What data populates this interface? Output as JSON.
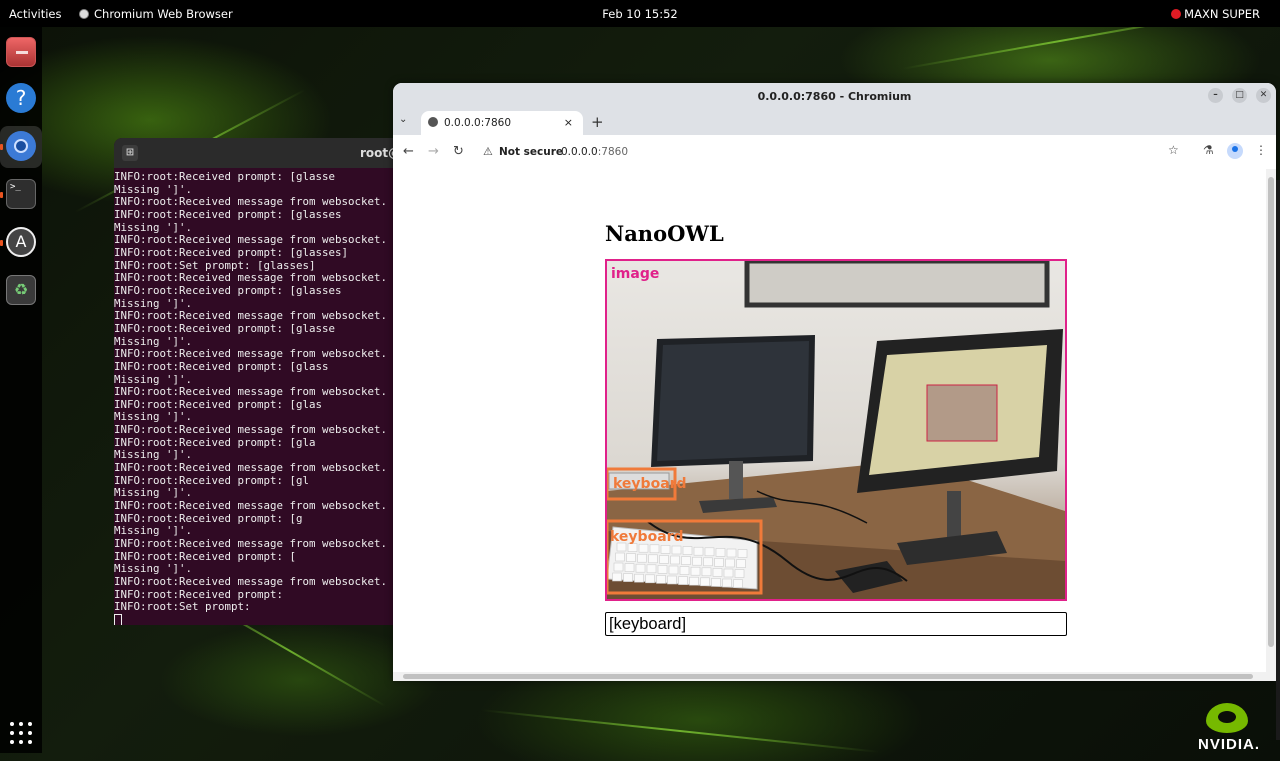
{
  "topbar": {
    "activities": "Activities",
    "app_name": "Chromium Web Browser",
    "clock": "Feb 10  15:52",
    "power_mode": "MAXN SUPER"
  },
  "dock": {
    "items": [
      "files-icon",
      "help-icon",
      "chromium-icon",
      "terminal-icon",
      "software-icon",
      "trash-icon"
    ],
    "terminal_glyph": ">_",
    "help_glyph": "?"
  },
  "terminal": {
    "title": "root@",
    "lines": [
      "INFO:root:Received prompt: [glasse",
      "Missing ']'.",
      "INFO:root:Received message from websocket.",
      "INFO:root:Received prompt: [glasses",
      "Missing ']'.",
      "INFO:root:Received message from websocket.",
      "INFO:root:Received prompt: [glasses]",
      "INFO:root:Set prompt: [glasses]",
      "INFO:root:Received message from websocket.",
      "INFO:root:Received prompt: [glasses",
      "Missing ']'.",
      "INFO:root:Received message from websocket.",
      "INFO:root:Received prompt: [glasse",
      "Missing ']'.",
      "INFO:root:Received message from websocket.",
      "INFO:root:Received prompt: [glass",
      "Missing ']'.",
      "INFO:root:Received message from websocket.",
      "INFO:root:Received prompt: [glas",
      "Missing ']'.",
      "INFO:root:Received message from websocket.",
      "INFO:root:Received prompt: [gla",
      "Missing ']'.",
      "INFO:root:Received message from websocket.",
      "INFO:root:Received prompt: [gl",
      "Missing ']'.",
      "INFO:root:Received message from websocket.",
      "INFO:root:Received prompt: [g",
      "Missing ']'.",
      "INFO:root:Received message from websocket.",
      "INFO:root:Received prompt: [",
      "Missing ']'.",
      "INFO:root:Received message from websocket.",
      "INFO:root:Received prompt:",
      "INFO:root:Set prompt:"
    ]
  },
  "browser": {
    "window_title": "0.0.0.0:7860 - Chromium",
    "tab_title": "0.0.0.0:7860",
    "security_label": "Not secure",
    "url_host": "0.0.0.0",
    "url_port": ":7860",
    "tab_close": "×",
    "new_tab": "+"
  },
  "page": {
    "heading": "NanoOWL",
    "image_label": "image",
    "detections": [
      "keyboard",
      "keyboard"
    ],
    "prompt_value": "[keyboard]"
  },
  "colors": {
    "accent_pink": "#e0218a",
    "detection_orange": "#f07a3a",
    "terminal_bg": "#300a24",
    "nvidia_green": "#76b900"
  },
  "brand": "NVIDIA."
}
